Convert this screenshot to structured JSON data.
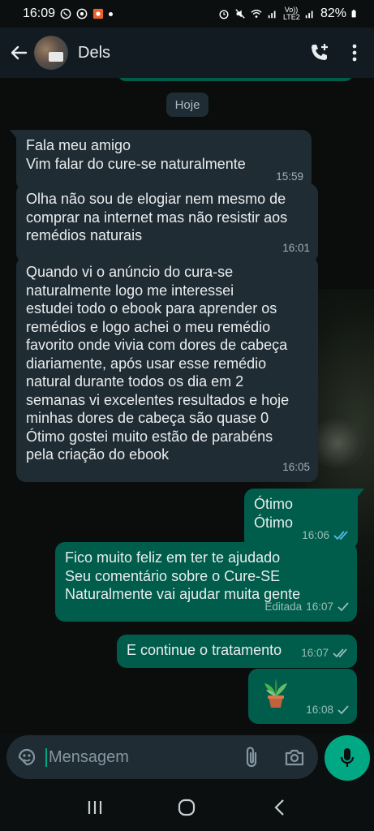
{
  "status_bar": {
    "time": "16:09",
    "battery": "82%",
    "network_label": "Vo)) LTE2"
  },
  "header": {
    "contact_name": "Dels"
  },
  "chat": {
    "date_chip": "Hoje",
    "messages": [
      {
        "direction": "incoming",
        "lines": [
          "Fala meu amigo",
          "Vim falar do cure-se naturalmente"
        ],
        "time": "15:59"
      },
      {
        "direction": "incoming",
        "lines": [
          "Olha não sou de elogiar nem mesmo de",
          "comprar na internet mas não resistir aos",
          "remédios naturais"
        ],
        "time": "16:01"
      },
      {
        "direction": "incoming",
        "lines": [
          "Quando vi o anúncio do cura-se",
          "naturalmente logo me interessei",
          "estudei todo o ebook para aprender os",
          "remédios e logo achei o meu remédio",
          "favorito onde vivia com dores de cabeça",
          "diariamente, após usar esse remédio",
          "natural durante todos os dia em 2",
          "semanas vi excelentes resultados e hoje",
          "minhas dores de cabeça são quase 0",
          "Ótimo gostei muito estão de parabéns",
          "pela criação do ebook"
        ],
        "time": "16:05"
      },
      {
        "direction": "outgoing",
        "lines": [
          "Ótimo",
          "Ótimo"
        ],
        "time": "16:06",
        "status": "read"
      },
      {
        "direction": "outgoing",
        "lines": [
          "Fico muito feliz em ter te ajudado",
          "Seu comentário sobre o Cure-SE",
          "Naturalmente vai ajudar muita gente"
        ],
        "edited_label": "Editada",
        "time": "16:07",
        "status": "sent"
      },
      {
        "direction": "outgoing",
        "lines": [
          "E continue o tratamento"
        ],
        "time": "16:07",
        "status": "delivered"
      },
      {
        "direction": "outgoing",
        "sticker": "potted-plant",
        "time": "16:08",
        "status": "sent"
      }
    ]
  },
  "input": {
    "placeholder": "Mensagem"
  },
  "colors": {
    "header_bg": "#111b21",
    "incoming_bubble": "#202c33",
    "outgoing_bubble": "#005c4b",
    "accent": "#00a884",
    "read_ticks": "#53bdeb"
  }
}
